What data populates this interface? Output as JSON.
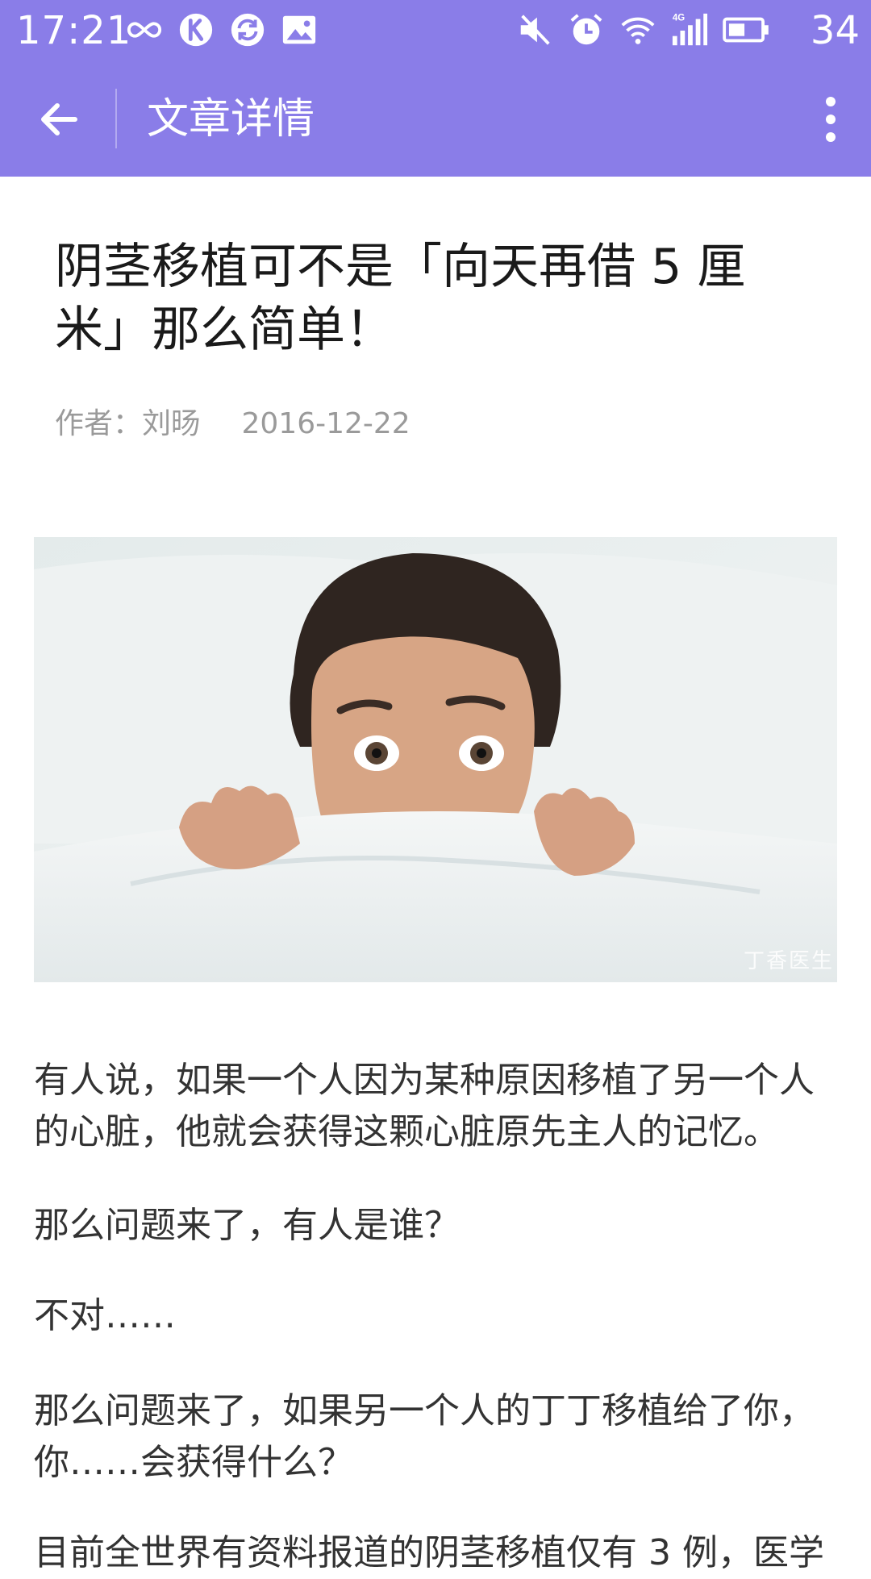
{
  "status_bar": {
    "time": "17:21",
    "battery_text": "34",
    "left_icons": [
      "infinity-icon",
      "k-app-icon",
      "sync-icon",
      "image-icon"
    ],
    "right_icons": [
      "mute-icon",
      "alarm-icon",
      "wifi-icon",
      "signal-4g-icon",
      "battery-icon"
    ],
    "network_label": "4G"
  },
  "app_bar": {
    "title": "文章详情",
    "back_icon": "arrow-left-icon",
    "more_icon": "more-vertical-icon"
  },
  "article": {
    "title": "阴茎移植可不是「向天再借 5 厘米」那么简单！",
    "author_label": "作者：",
    "author": "刘旸",
    "date": "2016-12-22",
    "image_watermark": "丁香医生",
    "paragraphs": [
      "有人说，如果一个人因为某种原因移植了另一个人的心脏，他就会获得这颗心脏原先主人的记忆。",
      "那么问题来了，有人是谁？",
      "不对……",
      "那么问题来了，如果另一个人的丁丁移植给了你，你……会获得什么？",
      "目前全世界有资料报道的阴茎移植仅有 3 例，医学"
    ]
  },
  "colors": {
    "primary": "#8a7de8",
    "title_text": "#1a1a1a",
    "meta_text": "#9a9a9a",
    "body_text": "#333333"
  }
}
